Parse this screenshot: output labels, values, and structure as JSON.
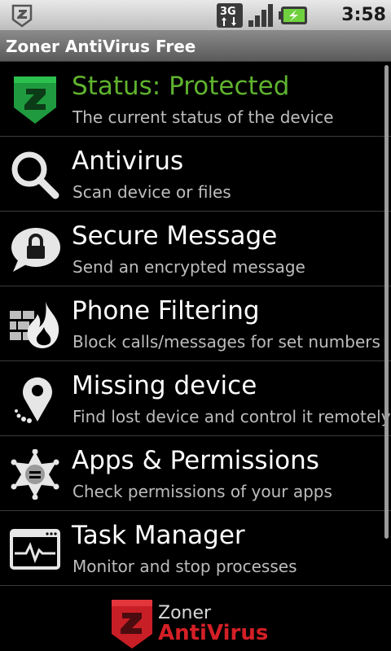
{
  "status_bar": {
    "network_badge": "3G",
    "time": "3:58 PM"
  },
  "app": {
    "title": "Zoner AntiVirus Free"
  },
  "colors": {
    "protected_green": "#5fb32f",
    "brand_red": "#d41f26",
    "subtitle_gray": "#bdbdbd"
  },
  "menu": {
    "items": [
      {
        "icon": "shield-icon",
        "title": "Status: Protected",
        "subtitle": "The current status of the device"
      },
      {
        "icon": "magnifier-icon",
        "title": "Antivirus",
        "subtitle": "Scan device or files"
      },
      {
        "icon": "lock-message-icon",
        "title": "Secure Message",
        "subtitle": "Send an encrypted message"
      },
      {
        "icon": "firewall-icon",
        "title": "Phone Filtering",
        "subtitle": "Block calls/messages for set numbers"
      },
      {
        "icon": "location-pin-icon",
        "title": "Missing device",
        "subtitle": "Find lost device and control it remotely"
      },
      {
        "icon": "sheriff-badge-icon",
        "title": "Apps & Permissions",
        "subtitle": "Check permissions of your apps"
      },
      {
        "icon": "task-monitor-icon",
        "title": "Task Manager",
        "subtitle": "Monitor and stop processes"
      }
    ]
  },
  "footer": {
    "brand_top": "Zoner",
    "brand_bottom": "AntiVirus"
  }
}
